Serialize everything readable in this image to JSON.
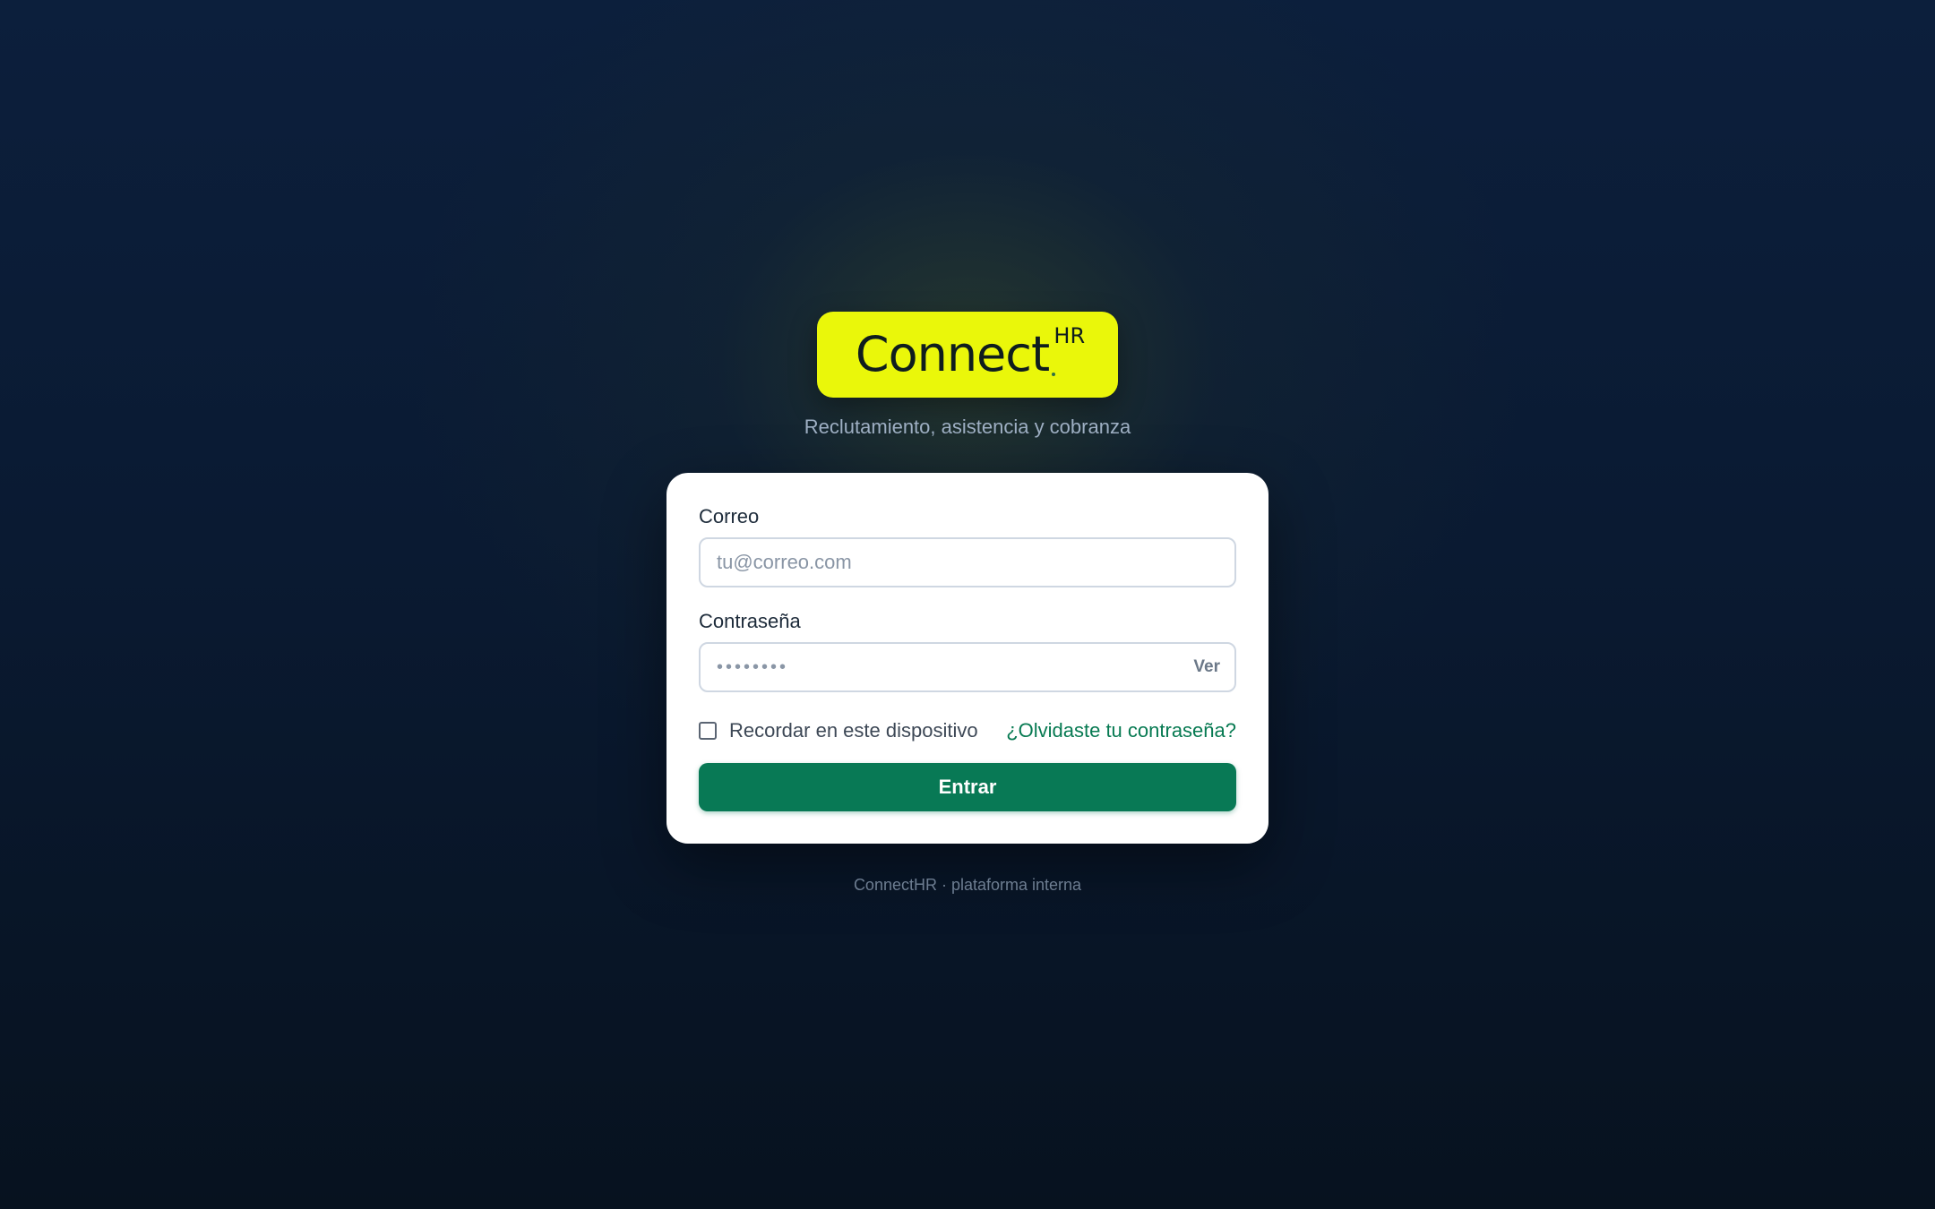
{
  "brand": {
    "logo_word": "Connect",
    "logo_sup": "HR",
    "accent_color": "#eaf70a",
    "tagline": "Reclutamiento, asistencia y cobranza"
  },
  "form": {
    "email": {
      "label": "Correo",
      "placeholder": "tu@correo.com",
      "value": ""
    },
    "password": {
      "label": "Contraseña",
      "masked_value": "••••••••",
      "show_label": "Ver"
    },
    "remember": {
      "label": "Recordar en este dispositivo",
      "checked": false
    },
    "forgot_label": "¿Olvidaste tu contraseña?",
    "submit_label": "Entrar",
    "primary_color": "#087955"
  },
  "footer": {
    "text": "ConnectHR · plataforma interna"
  }
}
